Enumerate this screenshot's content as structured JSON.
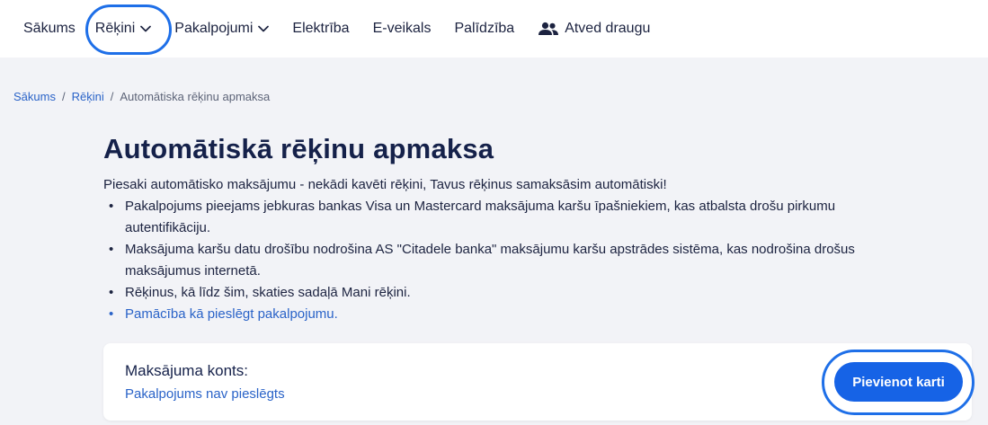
{
  "nav": {
    "items": [
      {
        "label": "Sākums",
        "has_dropdown": false
      },
      {
        "label": "Rēķini",
        "has_dropdown": true,
        "active": true
      },
      {
        "label": "Pakalpojumi",
        "has_dropdown": true
      },
      {
        "label": "Elektrība",
        "has_dropdown": false
      },
      {
        "label": "E-veikals",
        "has_dropdown": false
      },
      {
        "label": "Palīdzība",
        "has_dropdown": false
      },
      {
        "label": "Atved draugu",
        "has_dropdown": false,
        "icon": "people-icon"
      }
    ]
  },
  "breadcrumb": {
    "items": [
      "Sākums",
      "Rēķini",
      "Automātiska rēķinu apmaksa"
    ],
    "separator": "/"
  },
  "page": {
    "title": "Automātiskā rēķinu apmaksa",
    "intro": "Piesaki automātisko maksājumu - nekādi kavēti rēķini, Tavus rēķinus samaksāsim automātiski!",
    "bullets": [
      "Pakalpojums pieejams jebkuras bankas Visa un Mastercard maksājuma karšu īpašniekiem, kas atbalsta drošu pirkumu autentifikāciju.",
      "Maksājuma karšu datu drošību nodrošina AS \"Citadele banka\" maksājumu karšu apstrādes sistēma, kas nodrošina drošus maksājumus internetā.",
      "Rēķinus, kā līdz šim, skaties sadaļā Mani rēķini.",
      "Pamācība kā pieslēgt pakalpojumu."
    ]
  },
  "card": {
    "label": "Maksājuma konts:",
    "status": "Pakalpojums nav pieslēgts",
    "button_label": "Pievienot karti"
  },
  "colors": {
    "accent": "#1663e6",
    "focus_ring": "#1e6fe8",
    "link": "#2a63c8",
    "title": "#15214a",
    "background": "#f2f3f7"
  }
}
